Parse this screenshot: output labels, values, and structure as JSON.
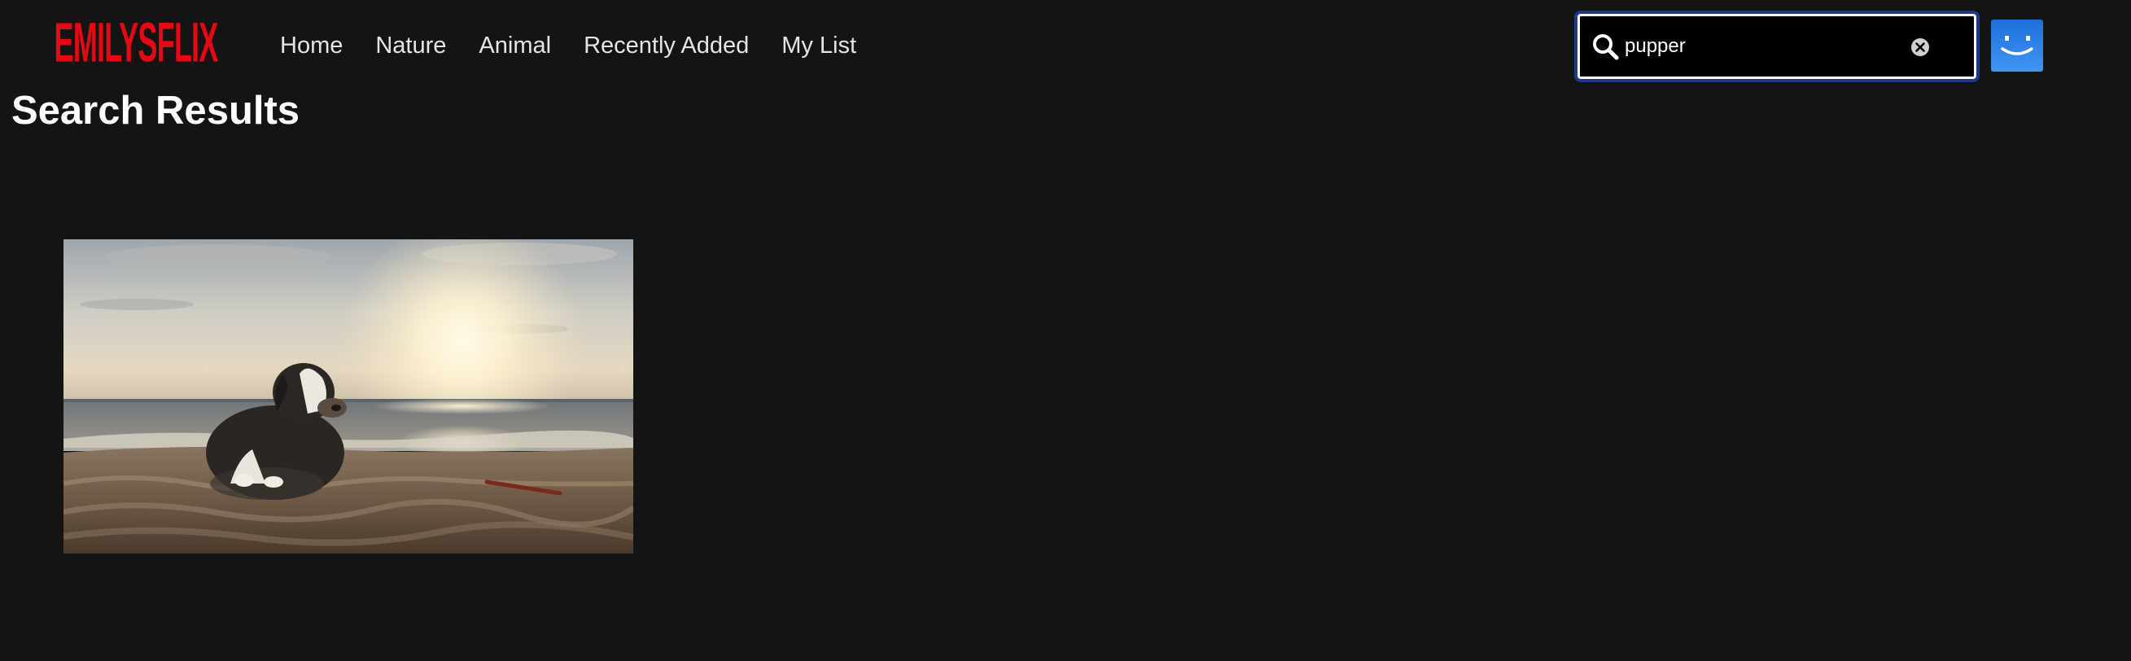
{
  "brand": {
    "logo_text": "EMILYSFLIX",
    "color": "#e50914"
  },
  "nav": {
    "items": [
      {
        "label": "Home"
      },
      {
        "label": "Nature"
      },
      {
        "label": "Animal"
      },
      {
        "label": "Recently Added"
      },
      {
        "label": "My List"
      }
    ]
  },
  "search": {
    "value": "pupper",
    "icon": "search-icon",
    "clear_icon": "clear-icon",
    "focus_ring_color": "#1b3a8a"
  },
  "profile": {
    "icon": "smiley-face-icon",
    "color": "#2f86ec"
  },
  "main": {
    "title": "Search Results",
    "results": [
      {
        "thumbnail": "puppy-on-beach-at-sunset"
      }
    ]
  },
  "colors": {
    "background": "#141414",
    "text": "#ffffff"
  }
}
